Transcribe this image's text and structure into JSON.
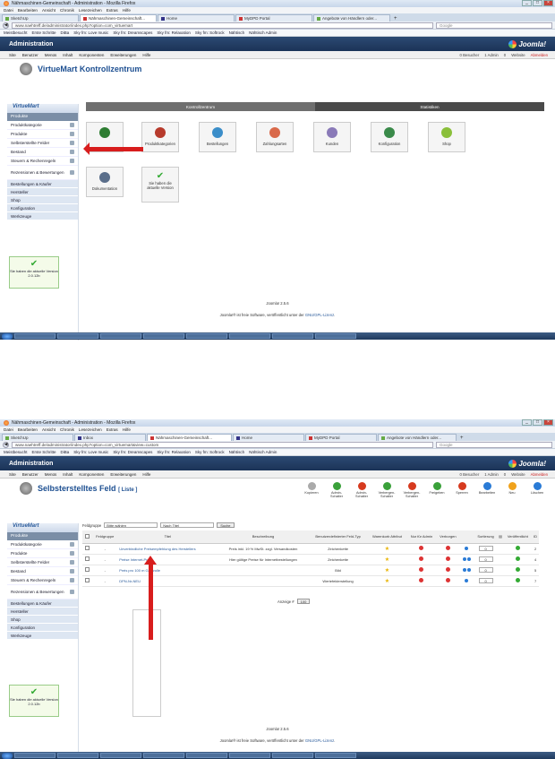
{
  "shot1": {
    "window_title": "Nähmaschinen-Gemeinschaft - Administration - Mozilla Firefox",
    "menu": [
      "Datei",
      "Bearbeiten",
      "Ansicht",
      "Chronik",
      "Lesezeichen",
      "Extras",
      "Hilfe"
    ],
    "tabs": [
      "SketchUp",
      "Nähmaschinen-Gemeinschaft...",
      "Home",
      "MyDPD Portal",
      "Angebote von Händlern oder..."
    ],
    "url": "www.naehtreff.de/administrator/index.php?option=com_virtuemart",
    "search_placeholder": "Google",
    "bookmarks": [
      "Meistbesucht",
      "Erste Schritte",
      "DiBa",
      "Sky fm: Love music",
      "Sky fm: Dreamscapes",
      "Sky fm: Relaxation",
      "Sky fm: Softrock",
      "Nähtisch",
      "Nähtisch Admin"
    ],
    "admin_title": "Administration",
    "joomla_logo": "Joomla!",
    "jmenu": [
      "Site",
      "Benutzer",
      "Menüs",
      "Inhalt",
      "Komponenten",
      "Erweiterungen",
      "Hilfe"
    ],
    "jstatus": [
      "0 Besucher",
      "1 Admin",
      "0",
      "Website"
    ],
    "jlogout": "Abmelden",
    "page_title": "VirtueMart Kontrollzentrum",
    "cp_tabs": [
      "Kontrollzentrum",
      "Statistiken"
    ],
    "tiles": [
      "",
      "Produktkategorien",
      "Bestellungen",
      "Zahlungsarten",
      "Kunden",
      "Konfiguration",
      "Shop",
      "Dokumentation",
      "Sie haben die aktuelle Version"
    ],
    "footer_version": "Joomla! 2.5.6",
    "footer_license_pre": "Joomla!® ist freie Software, veröffentlicht unter der",
    "footer_license_link": "GNU/GPL-Lizenz",
    "footer_license_post": "."
  },
  "shot2": {
    "window_title": "Nähmaschinen-Gemeinschaft - Administration - Mozilla Firefox",
    "menu": [
      "Datei",
      "Bearbeiten",
      "Ansicht",
      "Chronik",
      "Lesezeichen",
      "Extras",
      "Hilfe"
    ],
    "tabs": [
      "SketchUp",
      "Inbox",
      "Nähmaschinen-Gemeinschaft...",
      "Home",
      "MyDPD Portal",
      "Angebote von Händlern oder..."
    ],
    "url": "www.naehtreff.de/administrator/index.php?option=com_virtuemart&view=custom",
    "search_placeholder": "Google",
    "bookmarks": [
      "Meistbesucht",
      "Erste Schritte",
      "DiBa",
      "Sky fm: Love music",
      "Sky fm: Dreamscapes",
      "Sky fm: Relaxation",
      "Sky fm: Softrock",
      "Nähtisch",
      "Nähtisch Admin"
    ],
    "admin_title": "Administration",
    "joomla_logo": "Joomla!",
    "jmenu": [
      "Site",
      "Benutzer",
      "Menüs",
      "Inhalt",
      "Komponenten",
      "Erweiterungen",
      "Hilfe"
    ],
    "jstatus": [
      "0 Besucher",
      "1 Admin",
      "0",
      "Website"
    ],
    "jlogout": "Abmelden",
    "page_title": "Selbsterstelltes Feld",
    "page_subtitle": "[ Liste ]",
    "toolbar": [
      "Kopieren",
      "Admin-Schalter",
      "Admin-Schalter",
      "Verbergen-Schalter",
      "Verbergen-Schalter",
      "Freigeben",
      "Sperren",
      "Bearbeiten",
      "Neu",
      "Löschen"
    ],
    "toolbar_colors": [
      "#aaaaaa",
      "#3aa13a",
      "#d63a1f",
      "#3aa13a",
      "#d63a1f",
      "#3aa13a",
      "#d63a1f",
      "#2a7bd6",
      "#f0a21c",
      "#2a7bd6"
    ],
    "filter_label": "Feldgruppe",
    "filter_value": "Bitte wählen",
    "filter_title_placeholder": "Nach Titel",
    "filter_button": "Suche",
    "columns": [
      "Feldgruppe",
      "Titel",
      "Beschreibung",
      "Benutzerdefinierter Feld-Typ",
      "Warenkorb Attribut",
      "Nur für Admin",
      "Verborgen",
      "",
      "Sortierung",
      "",
      "Veröffentlicht",
      "ID"
    ],
    "rows": [
      {
        "group": "-",
        "title": "Unverbindliche Preisempfehlung des Herstellers",
        "desc": "Preis inkl. 19 % MwSt. zzgl. Versandkosten",
        "type": "Zeichenkette",
        "order": "0",
        "id": "2"
      },
      {
        "group": "-",
        "title": "Preise Internet-Preis",
        "desc": "Hier gültige Preise für Internetbestellungen",
        "type": "Zeichenkette",
        "order": "0",
        "id": "4"
      },
      {
        "group": "-",
        "title": "Preis pro 100 m Garnrolle",
        "desc": "",
        "type": "Bild",
        "order": "0",
        "id": "5"
      },
      {
        "group": "-",
        "title": "DPN-Nr-NEU",
        "desc": "",
        "type": "Wertefelderstellung",
        "order": "0",
        "id": "7"
      }
    ],
    "display_label": "Anzeige #",
    "display_value": "100",
    "footer_version": "Joomla! 2.5.6",
    "footer_license_pre": "Joomla!® ist freie Software, veröffentlicht unter der",
    "footer_license_link": "GNU/GPL-Lizenz",
    "footer_license_post": "."
  },
  "sidebar": {
    "logo": "VirtueMart",
    "selected": "Produkte",
    "items": [
      "Produktkategorie",
      "Produkte",
      "Selbsterstellte Felder",
      "Bestand",
      "Steuern & Rechenregeln",
      "Rezensionen & Bewertungen"
    ],
    "groups": [
      "Bestellungen & Käufer",
      "Hersteller",
      "Shop",
      "Konfiguration",
      "Werkzeuge"
    ],
    "version_text": "Sie haben die aktuelle Version",
    "version_number": "2.0.12b"
  }
}
